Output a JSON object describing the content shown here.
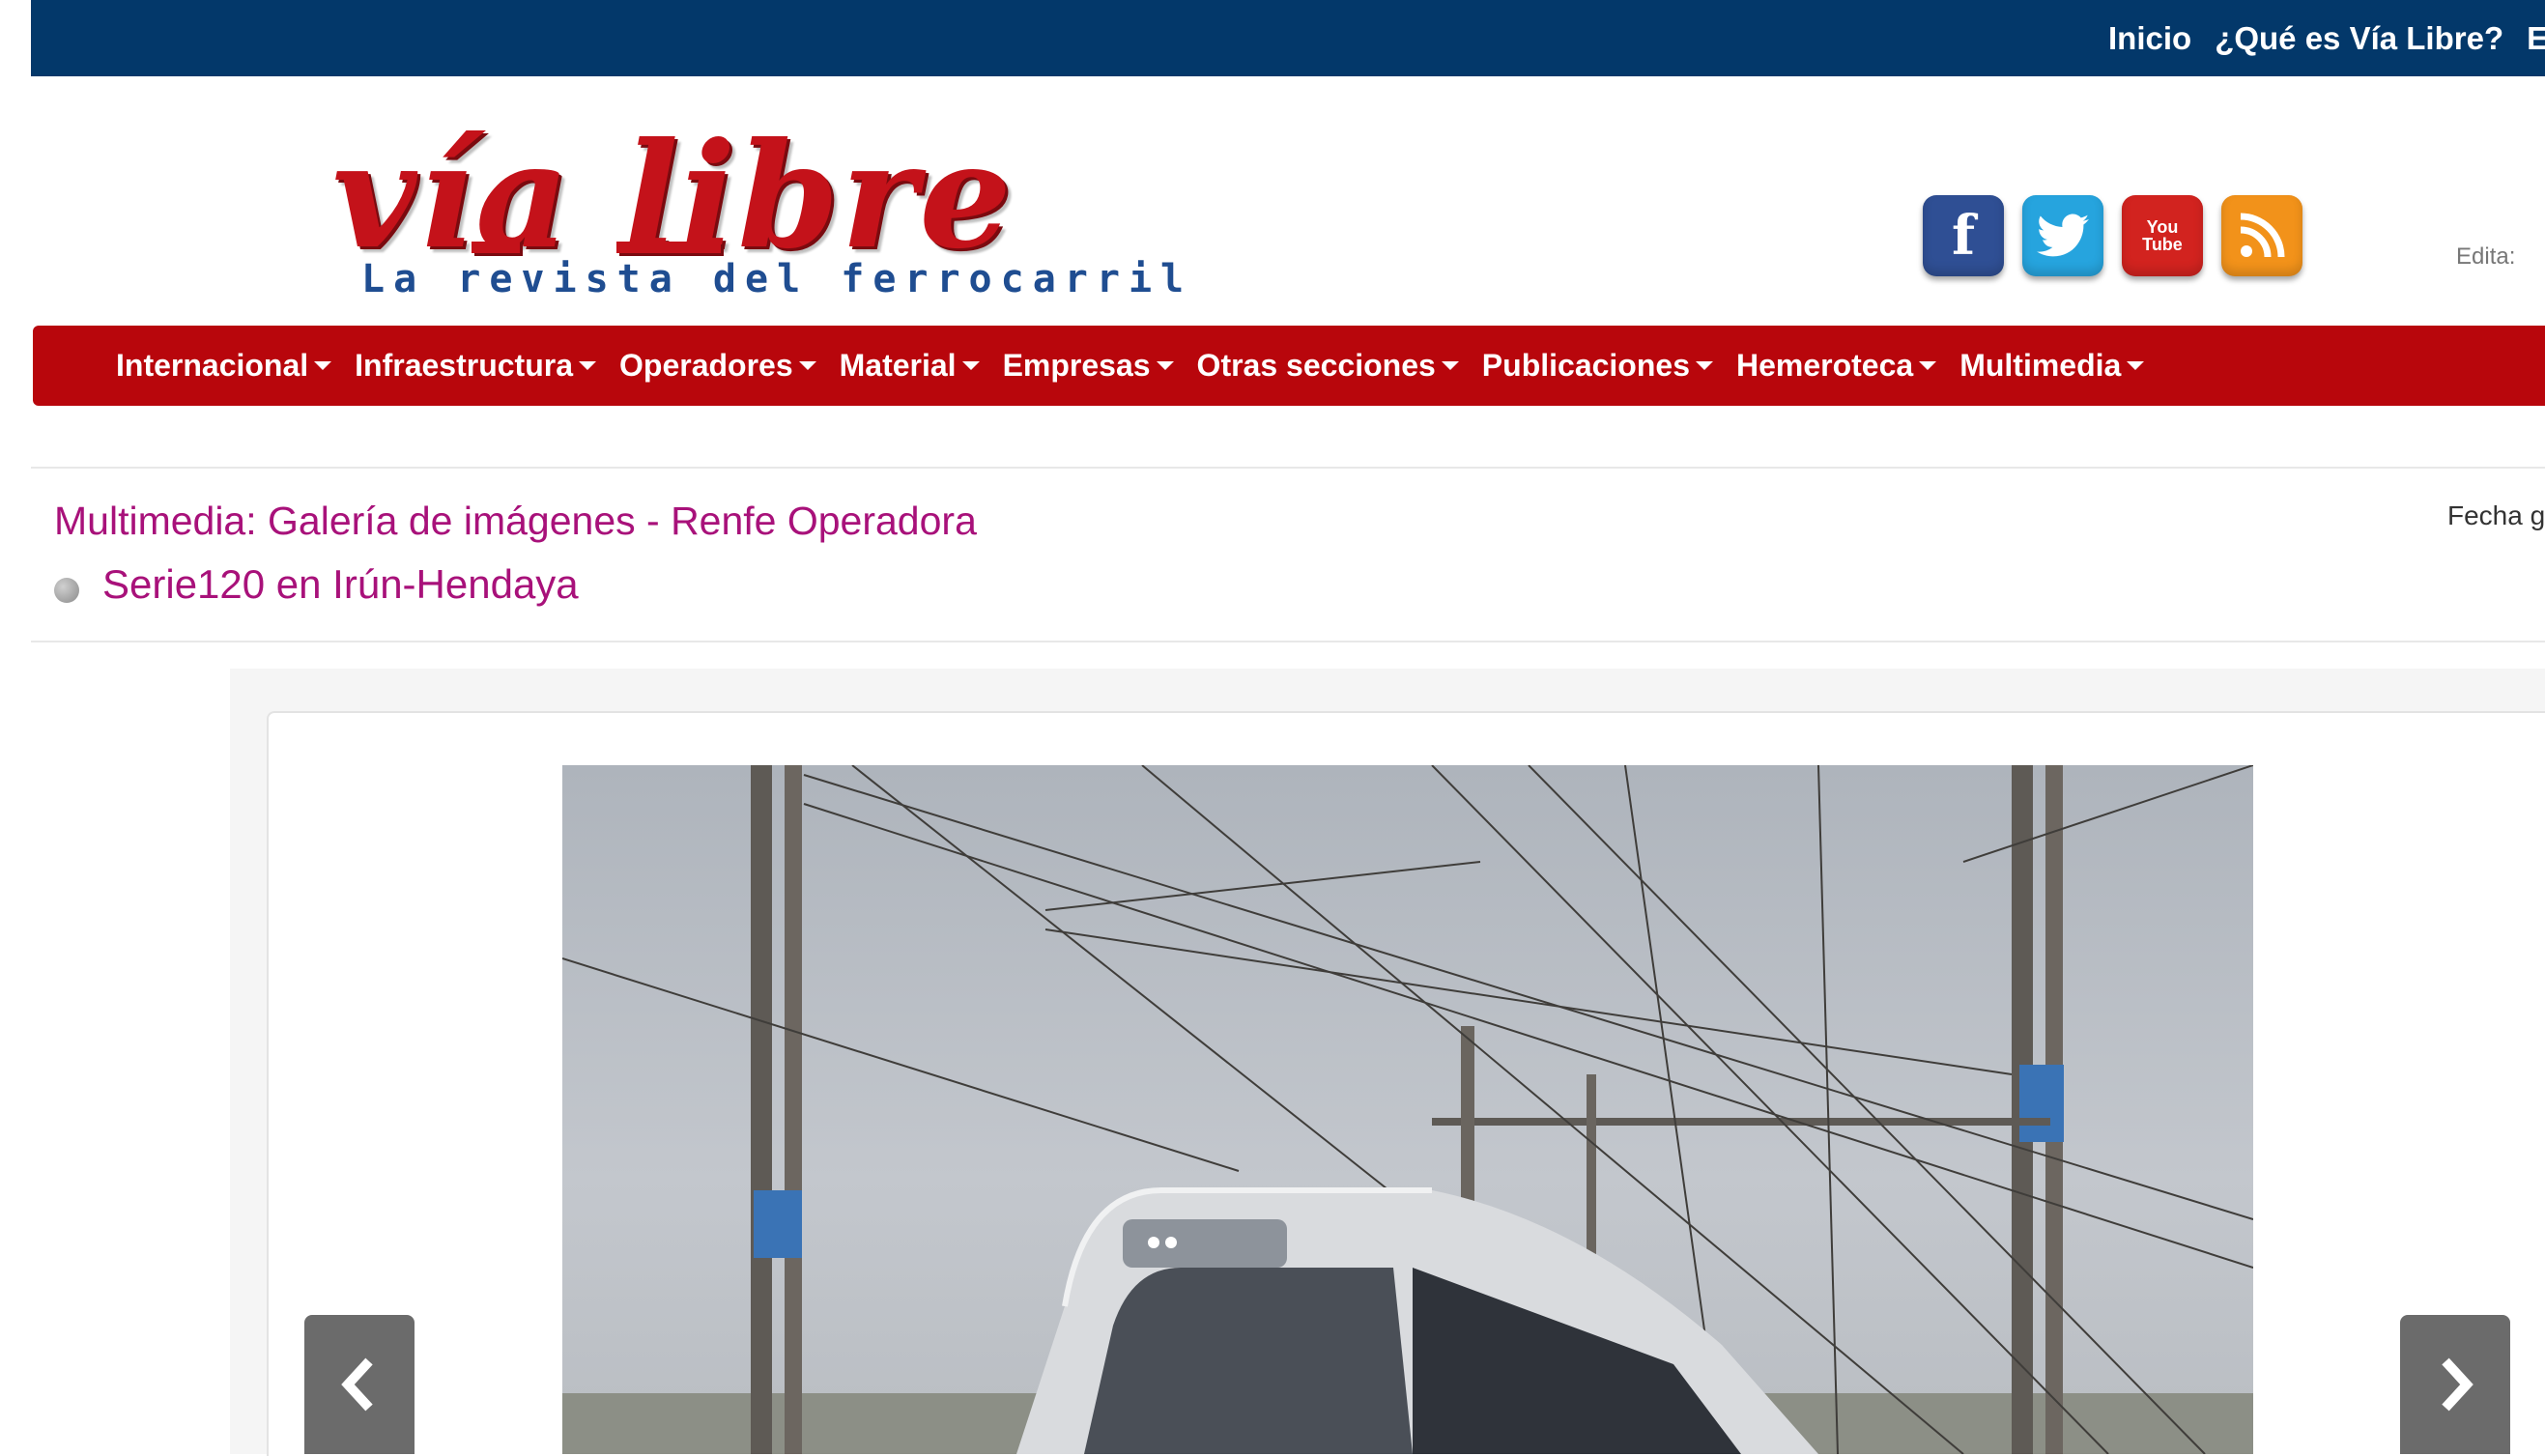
{
  "topbar": {
    "links": [
      "Inicio",
      "¿Qué es Vía Libre?",
      "Enla"
    ]
  },
  "logo": {
    "word": "vía libre",
    "tagline": "La revista del ferrocarril"
  },
  "social": {
    "icons": [
      "facebook-icon",
      "twitter-icon",
      "youtube-icon",
      "rss-icon"
    ],
    "youtube_text_1": "You",
    "youtube_text_2": "Tube"
  },
  "edita_label": "Edita:",
  "nav": {
    "items": [
      "Internacional",
      "Infraestructura",
      "Operadores",
      "Material",
      "Empresas",
      "Otras secciones",
      "Publicaciones",
      "Hemeroteca",
      "Multimedia"
    ]
  },
  "page": {
    "section_title": "Multimedia: Galería de imágenes - Renfe Operadora",
    "item_title": "Serie120 en Irún-Hendaya",
    "fecha_label": "Fecha g"
  },
  "gallery": {
    "prev_icon": "chevron-left-icon",
    "next_icon": "chevron-right-icon"
  },
  "colors": {
    "topbar": "#03386a",
    "nav": "#b8060c",
    "accent_text": "#a8117a",
    "logo_red": "#c4121a",
    "logo_blue": "#1f4d91"
  }
}
